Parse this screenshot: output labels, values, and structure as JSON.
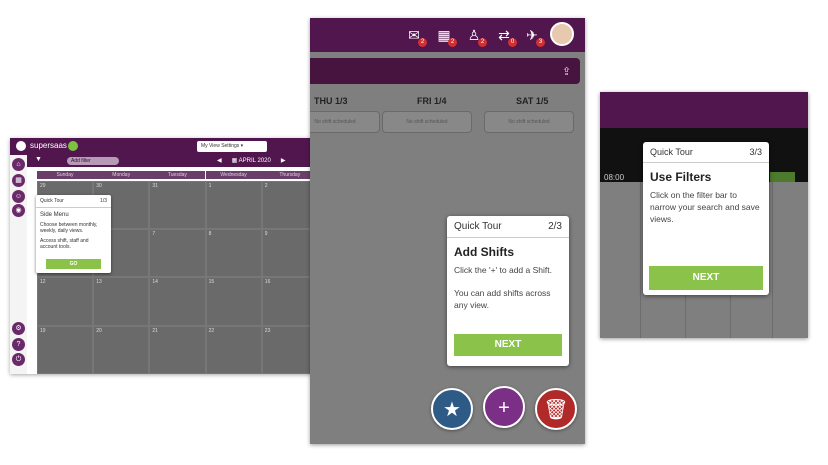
{
  "desktop": {
    "brand": "supersaas",
    "view_select": "My View Settings",
    "filter_chip": "Add filter",
    "month_label": "APRIL 2020",
    "day_headers": [
      "Sunday",
      "Monday",
      "Tuesday",
      "Wednesday",
      "Thursday",
      "Friday",
      "Saturday"
    ],
    "week_dates": [
      [
        "29",
        "30",
        "31",
        "1",
        "2",
        "3",
        "4"
      ],
      [
        "5",
        "6",
        "7",
        "8",
        "9",
        "10",
        "11"
      ],
      [
        "12",
        "13",
        "14",
        "15",
        "16",
        "17",
        "18"
      ],
      [
        "19",
        "20",
        "21",
        "22",
        "23",
        "24",
        "25"
      ]
    ],
    "tour": {
      "title": "Quick Tour",
      "step": "1/3",
      "heading": "Side Menu",
      "body1": "Choose between monthly, weekly, daily views.",
      "body2": "Access shift, staff and account tools.",
      "button": "GO"
    },
    "icons": {
      "fab_star": "star-icon",
      "fab_plus": "plus-icon",
      "fab_trash": "trash-icon"
    }
  },
  "mobile": {
    "days": [
      {
        "name": "THU 1/3",
        "box": "No shift scheduled"
      },
      {
        "name": "FRI 1/4",
        "box": "No shift scheduled"
      },
      {
        "name": "SAT 1/5",
        "box": "No shift scheduled"
      }
    ],
    "badges": [
      "2",
      "2",
      "2",
      "0",
      "3"
    ],
    "tour": {
      "title": "Quick Tour",
      "step": "2/3",
      "heading": "Add Shifts",
      "body1": "Click the '+' to add a Shift.",
      "body2": "You can add shifts across any view.",
      "button": "NEXT"
    }
  },
  "filters": {
    "time": "08:00",
    "tour": {
      "title": "Quick Tour",
      "step": "3/3",
      "heading": "Use Filters",
      "body": "Click on the filter bar to narrow your search and save views.",
      "button": "NEXT"
    }
  },
  "colors": {
    "brand_purple": "#52164f",
    "accent_green": "#8bc34a",
    "fab_blue": "#2e5b86",
    "fab_purple": "#7b2f87",
    "fab_red": "#b02a2a"
  }
}
